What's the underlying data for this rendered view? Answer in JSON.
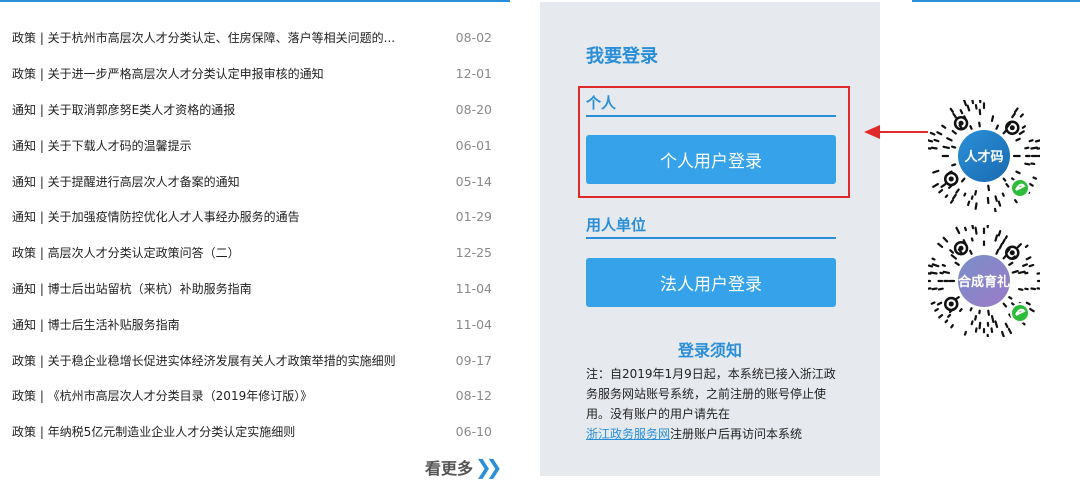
{
  "news": [
    {
      "title": "政策 | 关于杭州市高层次人才分类认定、住房保障、落户等相关问题的...",
      "date": "08-02"
    },
    {
      "title": "政策 | 关于进一步严格高层次人才分类认定申报审核的通知",
      "date": "12-01"
    },
    {
      "title": "通知 | 关于取消郭彦努E类人才资格的通报",
      "date": "08-20"
    },
    {
      "title": "通知 | 关于下载人才码的温馨提示",
      "date": "06-01"
    },
    {
      "title": "通知 | 关于提醒进行高层次人才备案的通知",
      "date": "05-14"
    },
    {
      "title": "通知 | 关于加强疫情防控优化人才人事经办服务的通告",
      "date": "01-29"
    },
    {
      "title": "政策 | 高层次人才分类认定政策问答（二）",
      "date": "12-25"
    },
    {
      "title": "通知 | 博士后出站留杭（来杭）补助服务指南",
      "date": "11-04"
    },
    {
      "title": "通知 | 博士后生活补贴服务指南",
      "date": "11-04"
    },
    {
      "title": "政策 | 关于稳企业稳增长促进实体经济发展有关人才政策举措的实施细则",
      "date": "09-17"
    },
    {
      "title": "政策 | 《杭州市高层次人才分类目录（2019年修订版）》",
      "date": "08-12"
    },
    {
      "title": "政策 | 年纳税5亿元制造业企业人才分类认定实施细则",
      "date": "06-10"
    }
  ],
  "more": {
    "label": "看更多",
    "icon": "double-chevron-right-icon"
  },
  "login": {
    "title": "我要登录",
    "personal_label": "个人",
    "personal_button": "个人用户登录",
    "org_label": "用人单位",
    "org_button": "法人用户登录",
    "notice_title": "登录须知",
    "notice_text": "注：自2019年1月9日起，本系统已接入浙江政务服务网站账号系统，之前注册的账号停止使用。没有账户的用户请先在",
    "notice_link": "浙江政务服务网",
    "notice_suffix": "注册账户后再访问本系统"
  },
  "qr_codes": [
    {
      "text": "人才码",
      "colors": [
        "#2a8fd8",
        "#1a6bb0"
      ]
    },
    {
      "text": "合成育礼",
      "colors": [
        "#7a8fc8",
        "#9b7ac8"
      ]
    }
  ],
  "colors": {
    "accent": "#2a8fd8",
    "button": "#35a2ea",
    "highlight": "#e02a2a",
    "panel": "#e6e9ee",
    "wechat": "#2dbb3a"
  }
}
